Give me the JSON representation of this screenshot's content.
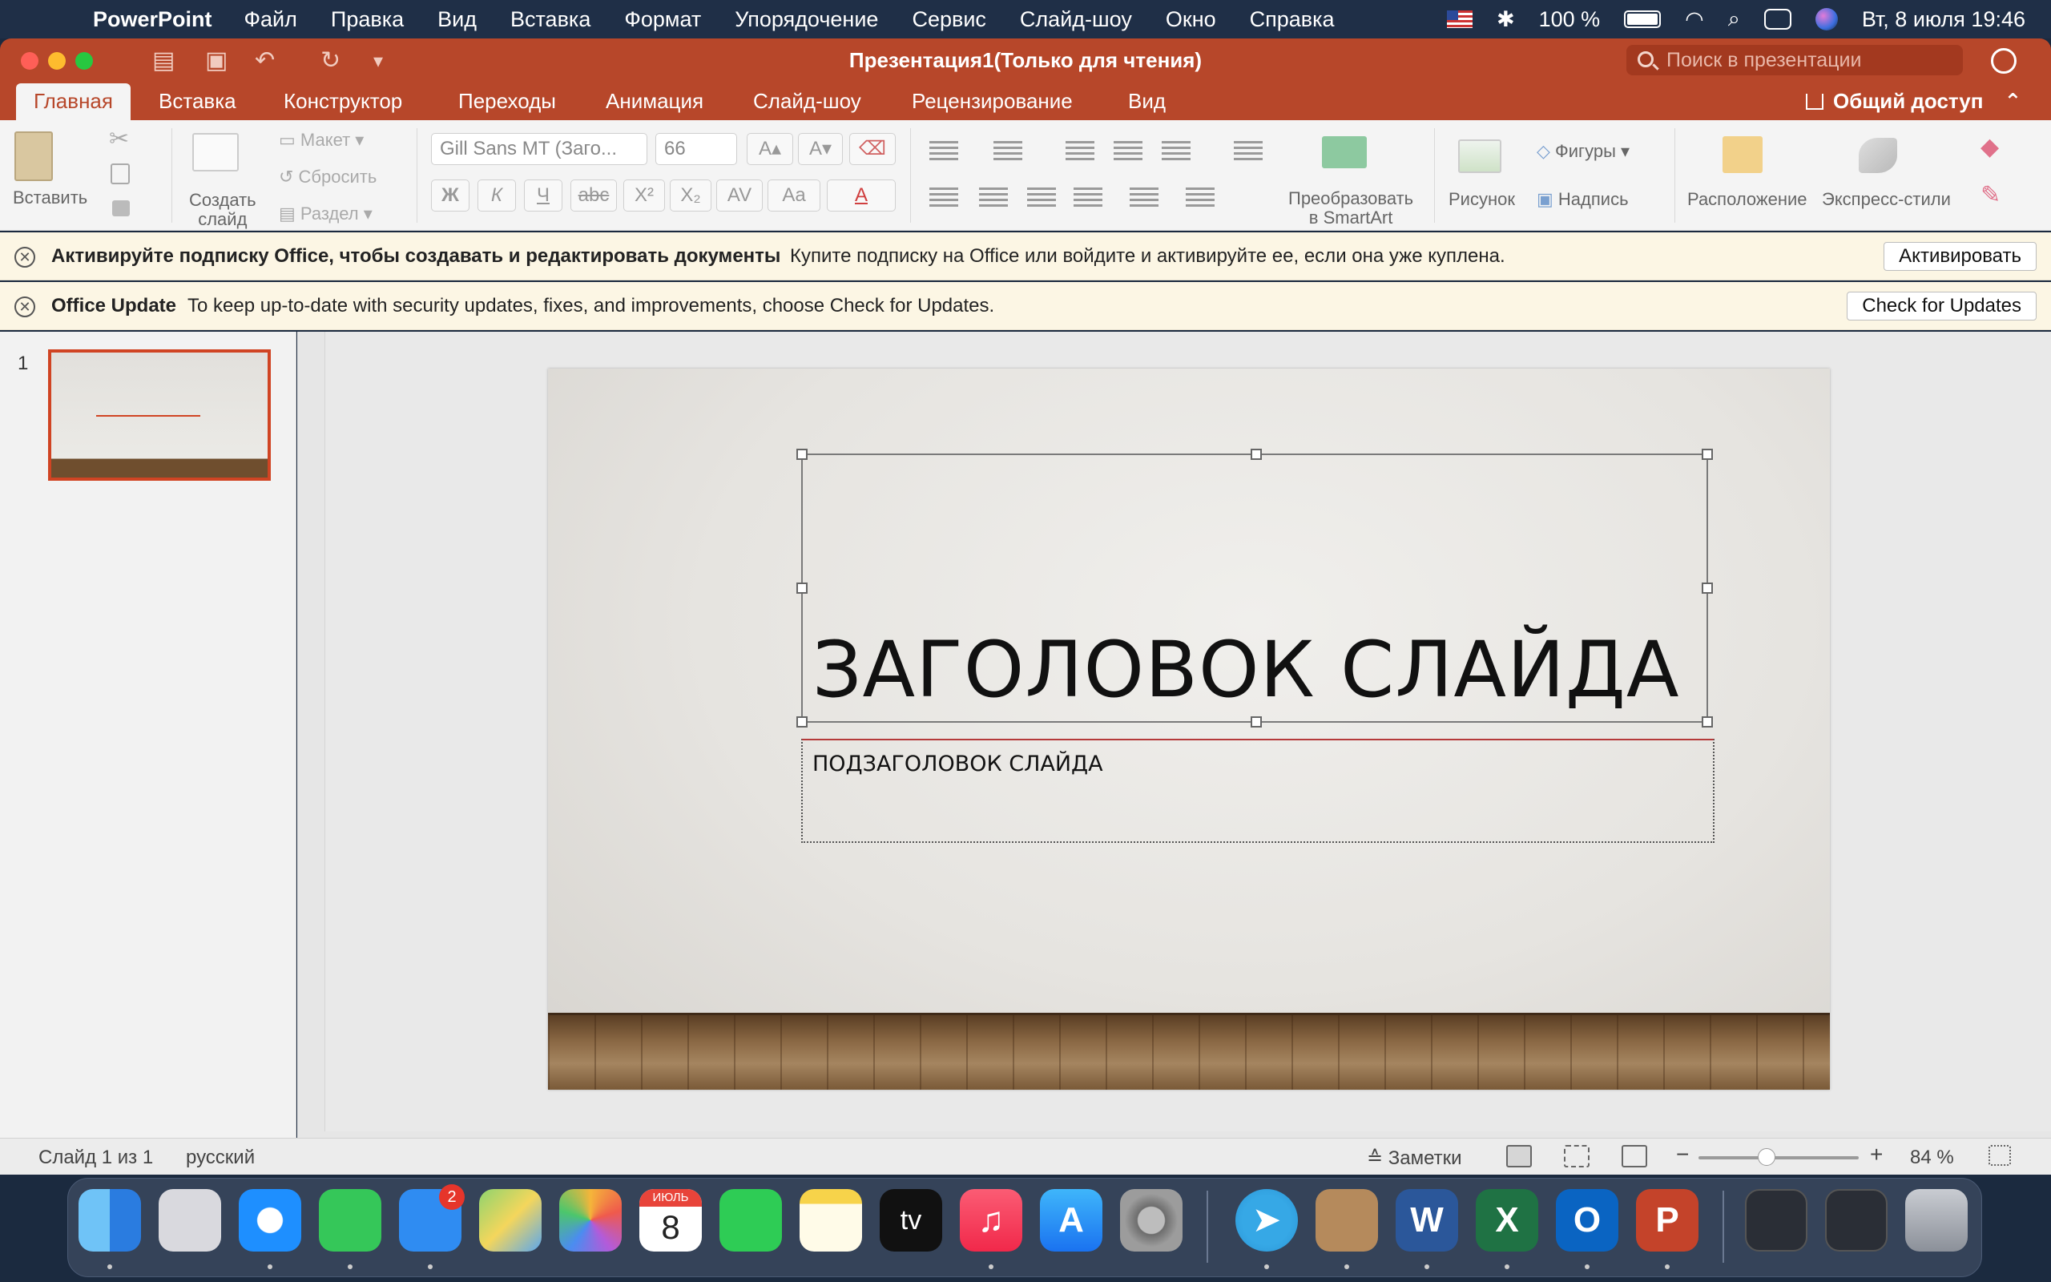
{
  "menubar": {
    "app_name": "PowerPoint",
    "items": [
      "Файл",
      "Правка",
      "Вид",
      "Вставка",
      "Формат",
      "Упорядочение",
      "Сервис",
      "Слайд-шоу",
      "Окно",
      "Справка"
    ],
    "battery": "100 %",
    "datetime": "Вт, 8 июля  19:46"
  },
  "window": {
    "title": "Презентация1(Только для чтения)",
    "search_placeholder": "Поиск в презентации"
  },
  "tabs": {
    "items": [
      "Главная",
      "Вставка",
      "Конструктор",
      "Переходы",
      "Анимация",
      "Слайд-шоу",
      "Рецензирование",
      "Вид"
    ],
    "active": "Главная",
    "share": "Общий доступ"
  },
  "ribbon": {
    "paste": "Вставить",
    "new_slide_line1": "Создать",
    "new_slide_line2": "слайд",
    "layout": "Макет",
    "reset": "Сбросить",
    "section": "Раздел",
    "font_name": "Gill Sans MT (Заго...",
    "font_size": "66",
    "bold": "Ж",
    "italic": "К",
    "underline": "Ч",
    "strike": "abc",
    "superscript": "X²",
    "subscript": "X₂",
    "smartart_line1": "Преобразовать",
    "smartart_line2": "в SmartArt",
    "picture": "Рисунок",
    "shapes": "Фигуры",
    "textbox": "Надпись",
    "arrange": "Расположение",
    "quick_styles": "Экспресс-стили"
  },
  "notifications": [
    {
      "title": "Активируйте подписку Office, чтобы создавать и редактировать документы",
      "message": "Купите подписку на Office или войдите и активируйте ее, если она уже куплена.",
      "button": "Активировать"
    },
    {
      "title": "Office Update",
      "message": "To keep up-to-date with security updates, fixes, and improvements, choose Check for Updates.",
      "button": "Check for Updates"
    }
  ],
  "thumbnails": {
    "slide_number": "1"
  },
  "slide": {
    "title": "ЗАГОЛОВОК СЛАЙДА",
    "subtitle": "ПОДЗАГОЛОВОК СЛАЙДА"
  },
  "statusbar": {
    "slide_counter": "Слайд 1 из 1",
    "language": "русский",
    "notes": "Заметки",
    "zoom": "84 %"
  },
  "dock": {
    "calendar_month": "ИЮЛЬ",
    "calendar_day": "8",
    "mail_badge": "2",
    "appletv_label": "tv"
  },
  "colors": {
    "accent": "#b7472a",
    "notification_bg": "#fcf6e4"
  }
}
